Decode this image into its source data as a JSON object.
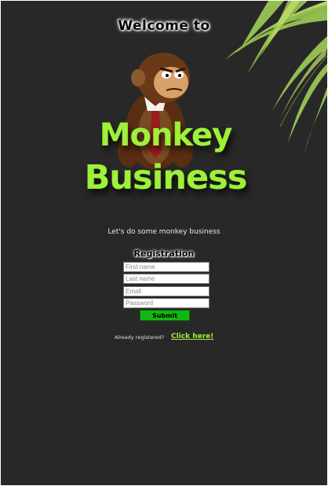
{
  "header": {
    "welcome": "Welcome to"
  },
  "logo": {
    "line1": "Monkey",
    "line2": "Business"
  },
  "tagline": "Let's do some monkey business",
  "registration": {
    "title": "Registration",
    "fields": {
      "first_name": {
        "placeholder": "First name",
        "value": ""
      },
      "last_name": {
        "placeholder": "Last name",
        "value": ""
      },
      "email": {
        "placeholder": "Email",
        "value": ""
      },
      "password": {
        "placeholder": "Password",
        "value": ""
      }
    },
    "submit_label": "Submit"
  },
  "login_prompt": {
    "text": "Already registered?",
    "link_label": "Click here!"
  },
  "colors": {
    "background": "#282828",
    "accent_green": "#9ef03a",
    "button_green": "#12b812",
    "leaf_green": "#a6d65a"
  },
  "icons": {
    "decoration": "palm-leaves-icon",
    "mascot": "monkey-mascot-icon"
  }
}
